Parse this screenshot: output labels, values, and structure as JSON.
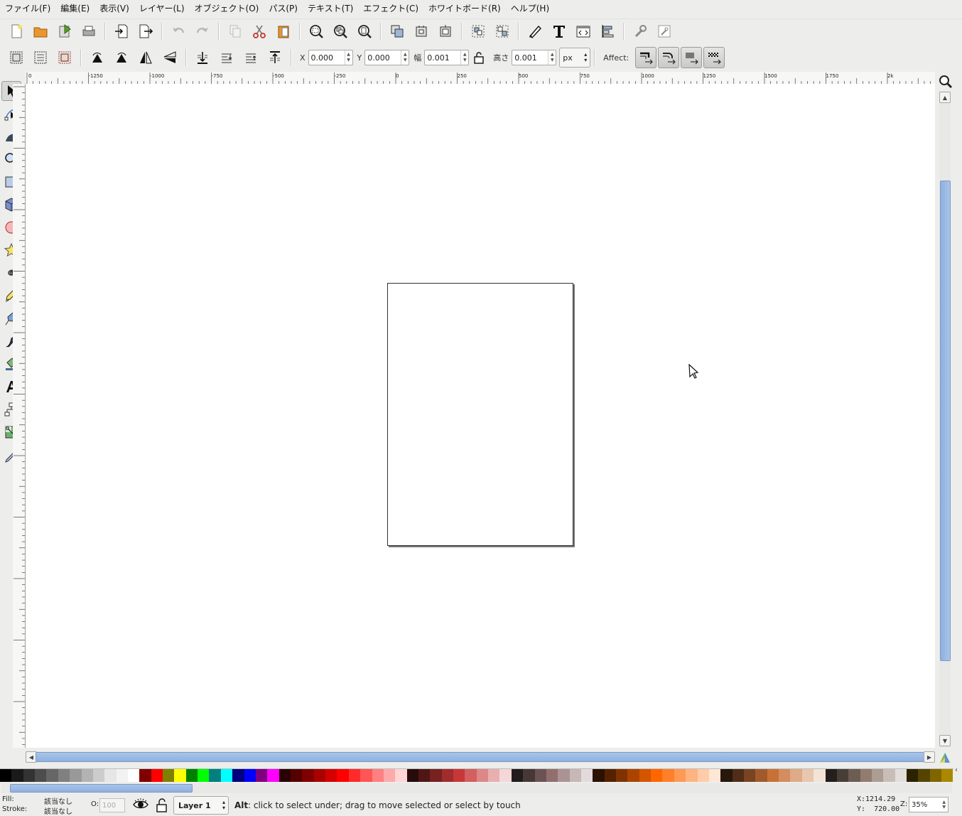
{
  "menu": [
    {
      "id": "file",
      "label": "ファイル(F)"
    },
    {
      "id": "edit",
      "label": "編集(E)"
    },
    {
      "id": "view",
      "label": "表示(V)"
    },
    {
      "id": "layer",
      "label": "レイヤー(L)"
    },
    {
      "id": "object",
      "label": "オブジェクト(O)"
    },
    {
      "id": "path",
      "label": "パス(P)"
    },
    {
      "id": "text",
      "label": "テキスト(T)"
    },
    {
      "id": "effect",
      "label": "エフェクト(C)"
    },
    {
      "id": "whiteboard",
      "label": "ホワイトボード(R)"
    },
    {
      "id": "help",
      "label": "ヘルプ(H)"
    }
  ],
  "selbar": {
    "x_label": "X",
    "x_value": "0.000",
    "y_label": "Y",
    "y_value": "0.000",
    "w_label": "幅",
    "w_value": "0.001",
    "h_label": "高さ",
    "h_value": "0.001",
    "unit": "px",
    "affect_label": "Affect:"
  },
  "ruler": {
    "h_labels": [
      "0",
      "-1250",
      "-1000",
      "-750",
      "-500",
      "-250",
      "0",
      "250",
      "500",
      "750",
      "1000",
      "1250",
      "1500",
      "1750",
      "2k"
    ]
  },
  "status": {
    "fill_label": "Fill:",
    "fill_value": "該当なし",
    "stroke_label": "Stroke:",
    "stroke_value": "該当なし",
    "opacity_label": "O:",
    "opacity_value": "100",
    "layer": "Layer 1",
    "message_key": "Alt",
    "message": ": click to select under; drag to move selected or select by touch",
    "x_coord": "X:1214.29",
    "y_coord": "Y:  720.00",
    "zoom_label": "Z:",
    "zoom_value": "35%"
  },
  "colors": {
    "accent": "#8fb1de",
    "palette": [
      "#000000",
      "#1a1a1a",
      "#333333",
      "#4d4d4d",
      "#666666",
      "#808080",
      "#999999",
      "#b3b3b3",
      "#cccccc",
      "#e6e6e6",
      "#f2f2f2",
      "#ffffff",
      "#800000",
      "#ff0000",
      "#808000",
      "#ffff00",
      "#008000",
      "#00ff00",
      "#008080",
      "#00ffff",
      "#000080",
      "#0000ff",
      "#800080",
      "#ff00ff",
      "#2b0000",
      "#550000",
      "#800000",
      "#aa0000",
      "#d40000",
      "#ff0000",
      "#ff2a2a",
      "#ff5555",
      "#ff8080",
      "#ffaaaa",
      "#ffd5d5",
      "#280b0b",
      "#501616",
      "#782121",
      "#a02c2c",
      "#c83737",
      "#d35f5f",
      "#de8787",
      "#e9afaf",
      "#f4d7d7",
      "#241c1c",
      "#483737",
      "#6c5353",
      "#916f6f",
      "#ac9393",
      "#c8b7b7",
      "#e3dbdb",
      "#2b1100",
      "#552200",
      "#803300",
      "#aa4400",
      "#d45500",
      "#ff6600",
      "#ff7f2a",
      "#ff9955",
      "#ffb380",
      "#ffccaa",
      "#ffe6d5",
      "#28170b",
      "#502d16",
      "#784421",
      "#a05a2c",
      "#c87137",
      "#d38d5f",
      "#deaa87",
      "#e9c6af",
      "#f4e3d7",
      "#241f1c",
      "#483e37",
      "#6c5d53",
      "#917c6f",
      "#ac9d93",
      "#c8beb7",
      "#e3dedb",
      "#2b2200",
      "#554400",
      "#806600",
      "#aa8800"
    ]
  }
}
